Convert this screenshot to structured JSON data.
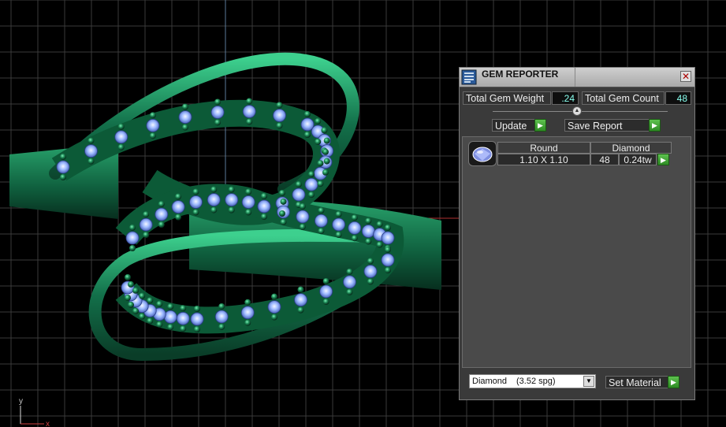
{
  "panel": {
    "title": "GEM REPORTER",
    "close_glyph": "✕",
    "total_weight_label": "Total Gem Weight",
    "total_weight_value": ".24",
    "total_count_label": "Total Gem Count",
    "total_count_value": "48",
    "update_label": "Update",
    "save_report_label": "Save Report",
    "row": {
      "shape": "Round",
      "material": "Diamond",
      "size": "1.10 X 1.10",
      "count": "48",
      "weight": "0.24tw"
    },
    "material_select": {
      "name": "Diamond",
      "spg": "(3.52 spg)"
    },
    "set_material_label": "Set Material",
    "icons": [
      "gem-reporter-app-icon",
      "close-icon",
      "slider-knob-icon",
      "play-arrow-icon",
      "round-gem-icon",
      "chevron-down-icon"
    ]
  },
  "viewport": {
    "axis_y_label": "y",
    "axis_x_label": "x",
    "colors": {
      "background": "#000000",
      "grid": "#3a3a3a",
      "metal": "#1f8a5a",
      "gem": "#8fb0ff",
      "accent_green": "#3fb33a"
    }
  }
}
